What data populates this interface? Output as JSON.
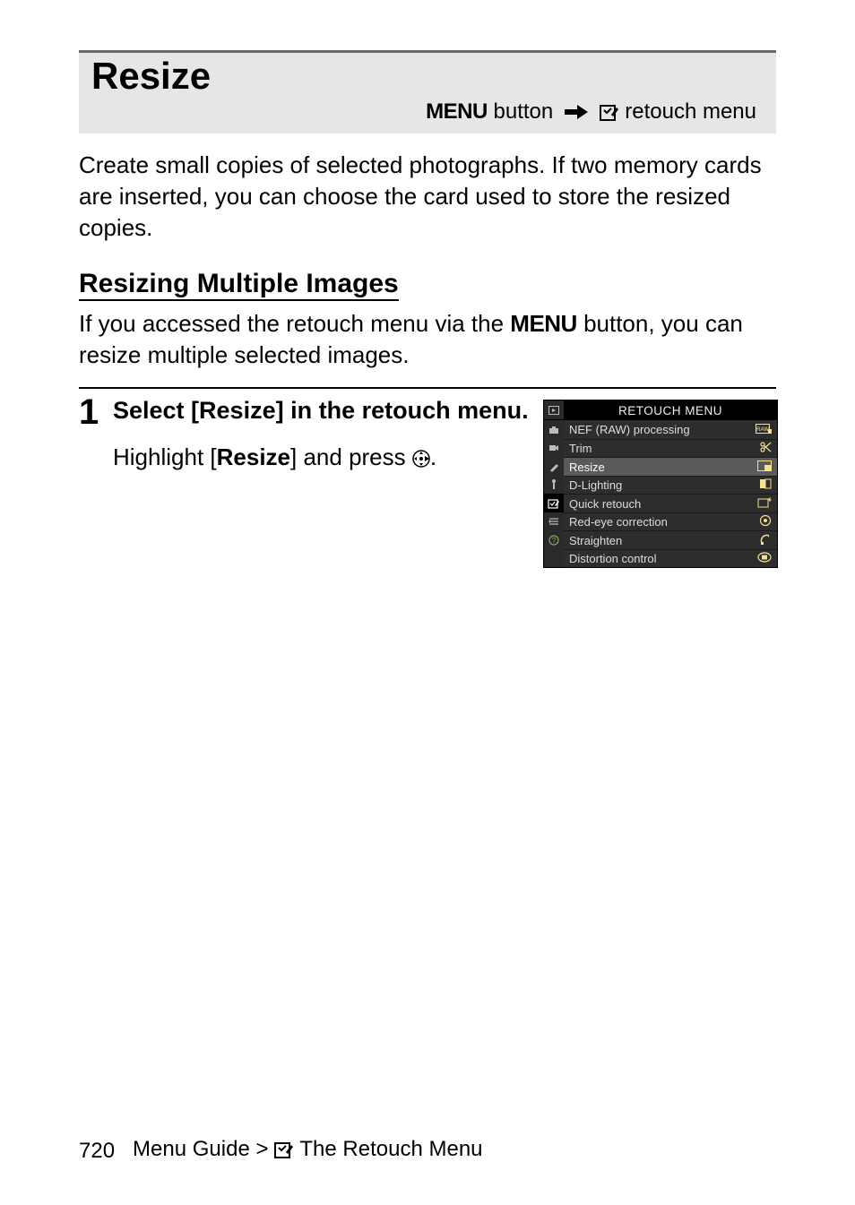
{
  "header": {
    "title": "Resize",
    "breadcrumb_menu": "MENU",
    "breadcrumb_button": " button ",
    "breadcrumb_target": " retouch menu"
  },
  "intro": "Create small copies of selected photographs. If two memory cards are inserted, you can choose the card used to store the resized copies.",
  "section": {
    "heading": "Resizing Multiple Images",
    "body_prefix": "If you accessed the retouch menu via the ",
    "body_menu": "MENU",
    "body_suffix": " button, you can resize multiple selected images."
  },
  "step": {
    "number": "1",
    "title_prefix": "Select [",
    "title_item": "Resize",
    "title_suffix": "] in the retouch menu.",
    "desc_prefix": "Highlight [",
    "desc_bold": "Resize",
    "desc_mid": "] and press ",
    "desc_suffix": "."
  },
  "camera_ui": {
    "title": "RETOUCH MENU",
    "side_icons": [
      "play",
      "camera",
      "movie",
      "pencil",
      "retouch-tool",
      "retouch-select",
      "mymenu",
      "help"
    ],
    "selected_side_index": 5,
    "items": [
      {
        "label": "NEF (RAW) processing",
        "icon": "raw-box"
      },
      {
        "label": "Trim",
        "icon": "scissors"
      },
      {
        "label": "Resize",
        "icon": "resize"
      },
      {
        "label": "D-Lighting",
        "icon": "d-lighting"
      },
      {
        "label": "Quick retouch",
        "icon": "quick-retouch"
      },
      {
        "label": "Red-eye correction",
        "icon": "red-eye"
      },
      {
        "label": "Straighten",
        "icon": "straighten"
      },
      {
        "label": "Distortion control",
        "icon": "distortion"
      }
    ],
    "highlighted_index": 2
  },
  "footer": {
    "page_number": "720",
    "path_prefix": "Menu Guide > ",
    "path_suffix": " The Retouch Menu"
  }
}
